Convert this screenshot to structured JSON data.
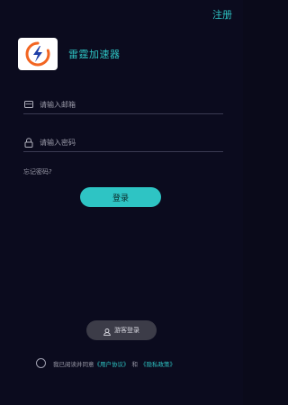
{
  "header": {
    "register_label": "注册"
  },
  "app": {
    "name": "雷霆加速器"
  },
  "form": {
    "email_placeholder": "请输入邮箱",
    "email_value": "",
    "password_placeholder": "请输入密码",
    "password_value": "",
    "forgot_label": "忘记密码?",
    "login_label": "登录"
  },
  "guest": {
    "label": "游客登录"
  },
  "agreement": {
    "prefix": "我已阅读并同意",
    "user_agreement": "《用户协议》",
    "and": "和",
    "privacy_policy": "《隐私政策》",
    "checked": false
  },
  "colors": {
    "background": "#0b0b1e",
    "accent": "#2ec4c4",
    "logo_orange": "#f26522",
    "logo_blue": "#1e3fa8"
  },
  "icons": {
    "logo": "lightning-circle-icon",
    "email": "mail-icon",
    "password": "lock-icon",
    "guest": "user-icon"
  }
}
